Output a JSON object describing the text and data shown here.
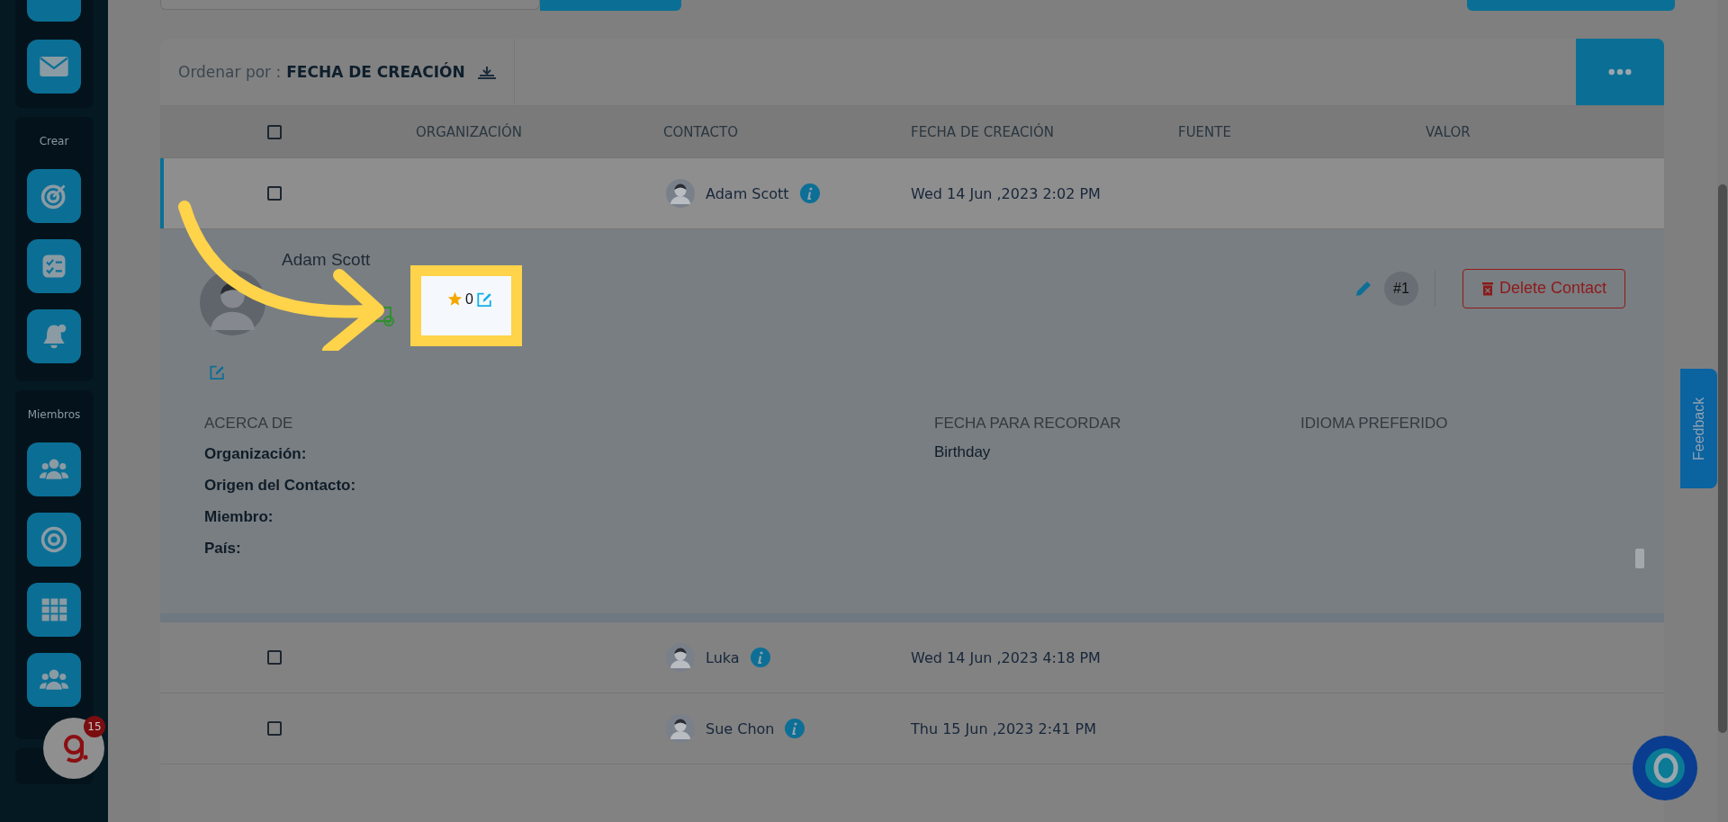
{
  "sidebar": {
    "groups": [
      {
        "label": "Crear"
      },
      {
        "label": "Miembros"
      }
    ],
    "notification_count": "15"
  },
  "sort": {
    "label": "Ordenar por :",
    "value": "FECHA DE CREACIÓN"
  },
  "table": {
    "header_checked": false,
    "columns": [
      "ORGANIZACIÓN",
      "CONTACTO",
      "FECHA DE CREACIÓN",
      "FUENTE",
      "VALOR"
    ],
    "rows": [
      {
        "checked": false,
        "contact": "Adam Scott",
        "created": "Wed 14 Jun ,2023 2:02 PM",
        "expanded": true
      },
      {
        "checked": false,
        "contact": "Luka",
        "created": "Wed 14 Jun ,2023 4:18 PM",
        "expanded": false
      },
      {
        "checked": false,
        "contact": "Sue Chon",
        "created": "Thu 15 Jun ,2023 2:41 PM",
        "expanded": false
      }
    ]
  },
  "detail": {
    "name": "Adam Scott",
    "rating": "0",
    "badge": "#1",
    "delete_button": "Delete Contact",
    "about_heading": "ACERCA DE",
    "about_fields": [
      "Organización:",
      "Origen del Contacto:",
      "Miembro:",
      "País:"
    ],
    "reminder_heading": "FECHA PARA RECORDAR",
    "reminder_value": "Birthday",
    "language_heading": "IDIOMA PREFERIDO"
  },
  "feedback_tab": "Feedback"
}
